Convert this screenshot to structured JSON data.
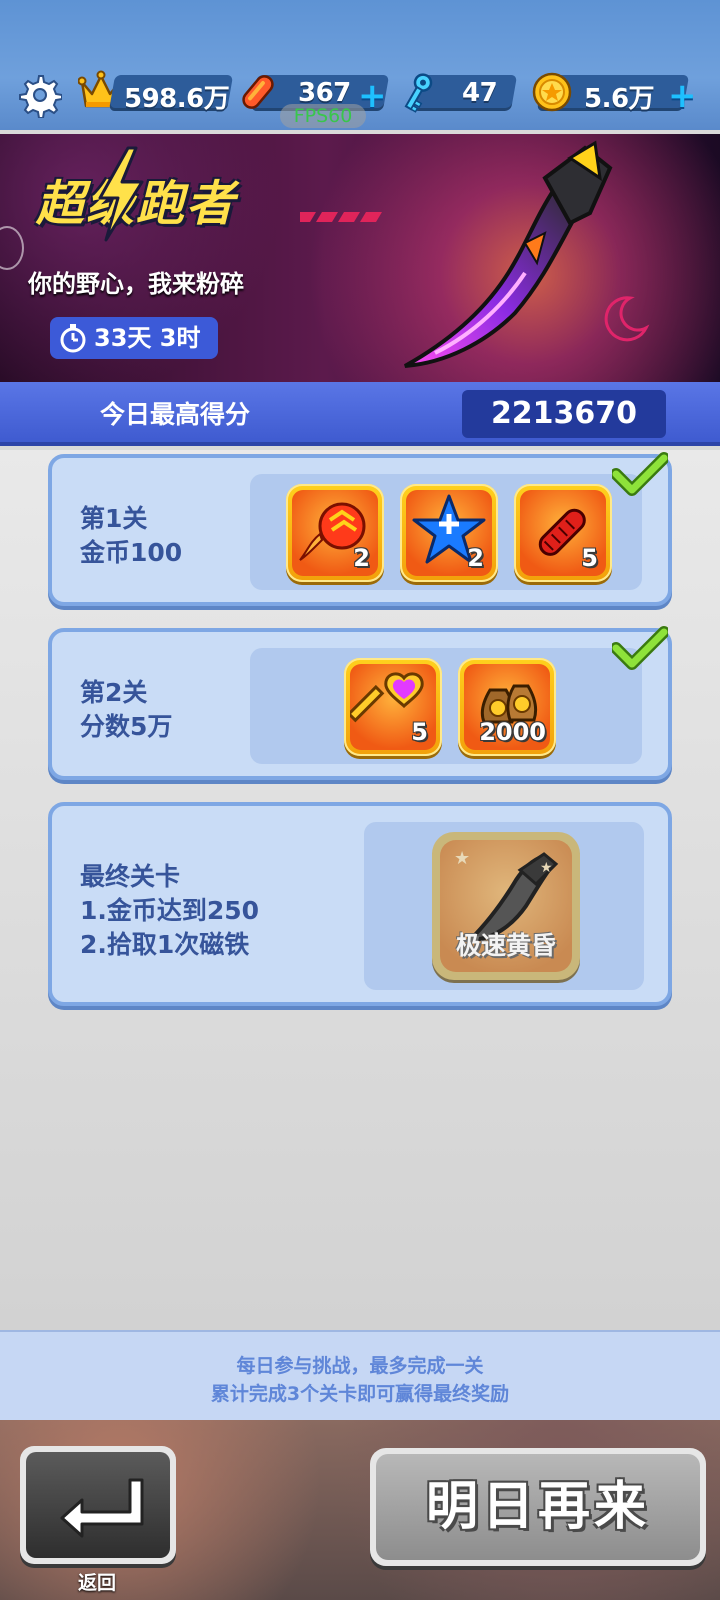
{
  "topbar": {
    "settings_icon": "gear-icon",
    "crown_value": "598.6万",
    "board_value": "367",
    "key_value": "47",
    "coin_value": "5.6万",
    "plus": "+",
    "fps": "FPS60"
  },
  "banner": {
    "title": "超级跑者",
    "subtitle": "你的野心，我来粉碎",
    "timer": "33天 3时"
  },
  "score": {
    "label": "今日最高得分",
    "value": "2213670"
  },
  "stages": [
    {
      "name": "第1关",
      "requirement": "金币100",
      "completed": true,
      "rewards": [
        {
          "icon": "flame-dash-icon",
          "count": "2"
        },
        {
          "icon": "star-boost-icon",
          "count": "2"
        },
        {
          "icon": "firecracker-icon",
          "count": "5"
        }
      ]
    },
    {
      "name": "第2关",
      "requirement": "分数5万",
      "completed": true,
      "rewards": [
        {
          "icon": "heart-key-icon",
          "count": "5"
        },
        {
          "icon": "money-bag-icon",
          "count": "2000"
        }
      ]
    },
    {
      "name": "最终关卡",
      "requirement_1": "1.金币达到250",
      "requirement_2": "2.拾取1次磁铁",
      "completed": false,
      "reward_label": "极速黄昏"
    }
  ],
  "info": {
    "line1": "每日参与挑战，最多完成一关",
    "line2": "累计完成3个关卡即可赢得最终奖励"
  },
  "buttons": {
    "back_label": "返回",
    "tomorrow_label": "明日再来"
  },
  "colors": {
    "accent_blue": "#3f5bd0",
    "card_bg": "#c9dcf6",
    "gold": "#f2a00a"
  }
}
